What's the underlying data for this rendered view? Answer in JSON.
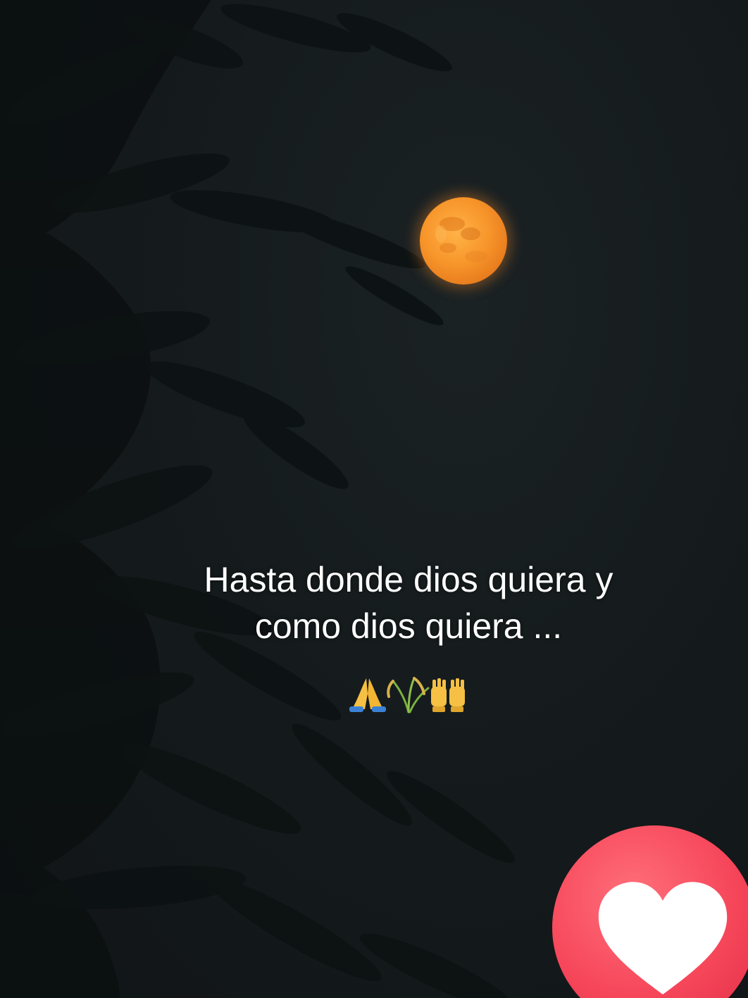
{
  "caption": {
    "line1": "Hasta donde dios quiera y",
    "line2": "como dios quiera ..."
  },
  "emojis": [
    "praying-hands",
    "sheaf-of-rice",
    "raising-hands"
  ],
  "like": {
    "icon": "heart-icon",
    "color": "#f6465a"
  },
  "moon": {
    "color": "#f7952a"
  }
}
